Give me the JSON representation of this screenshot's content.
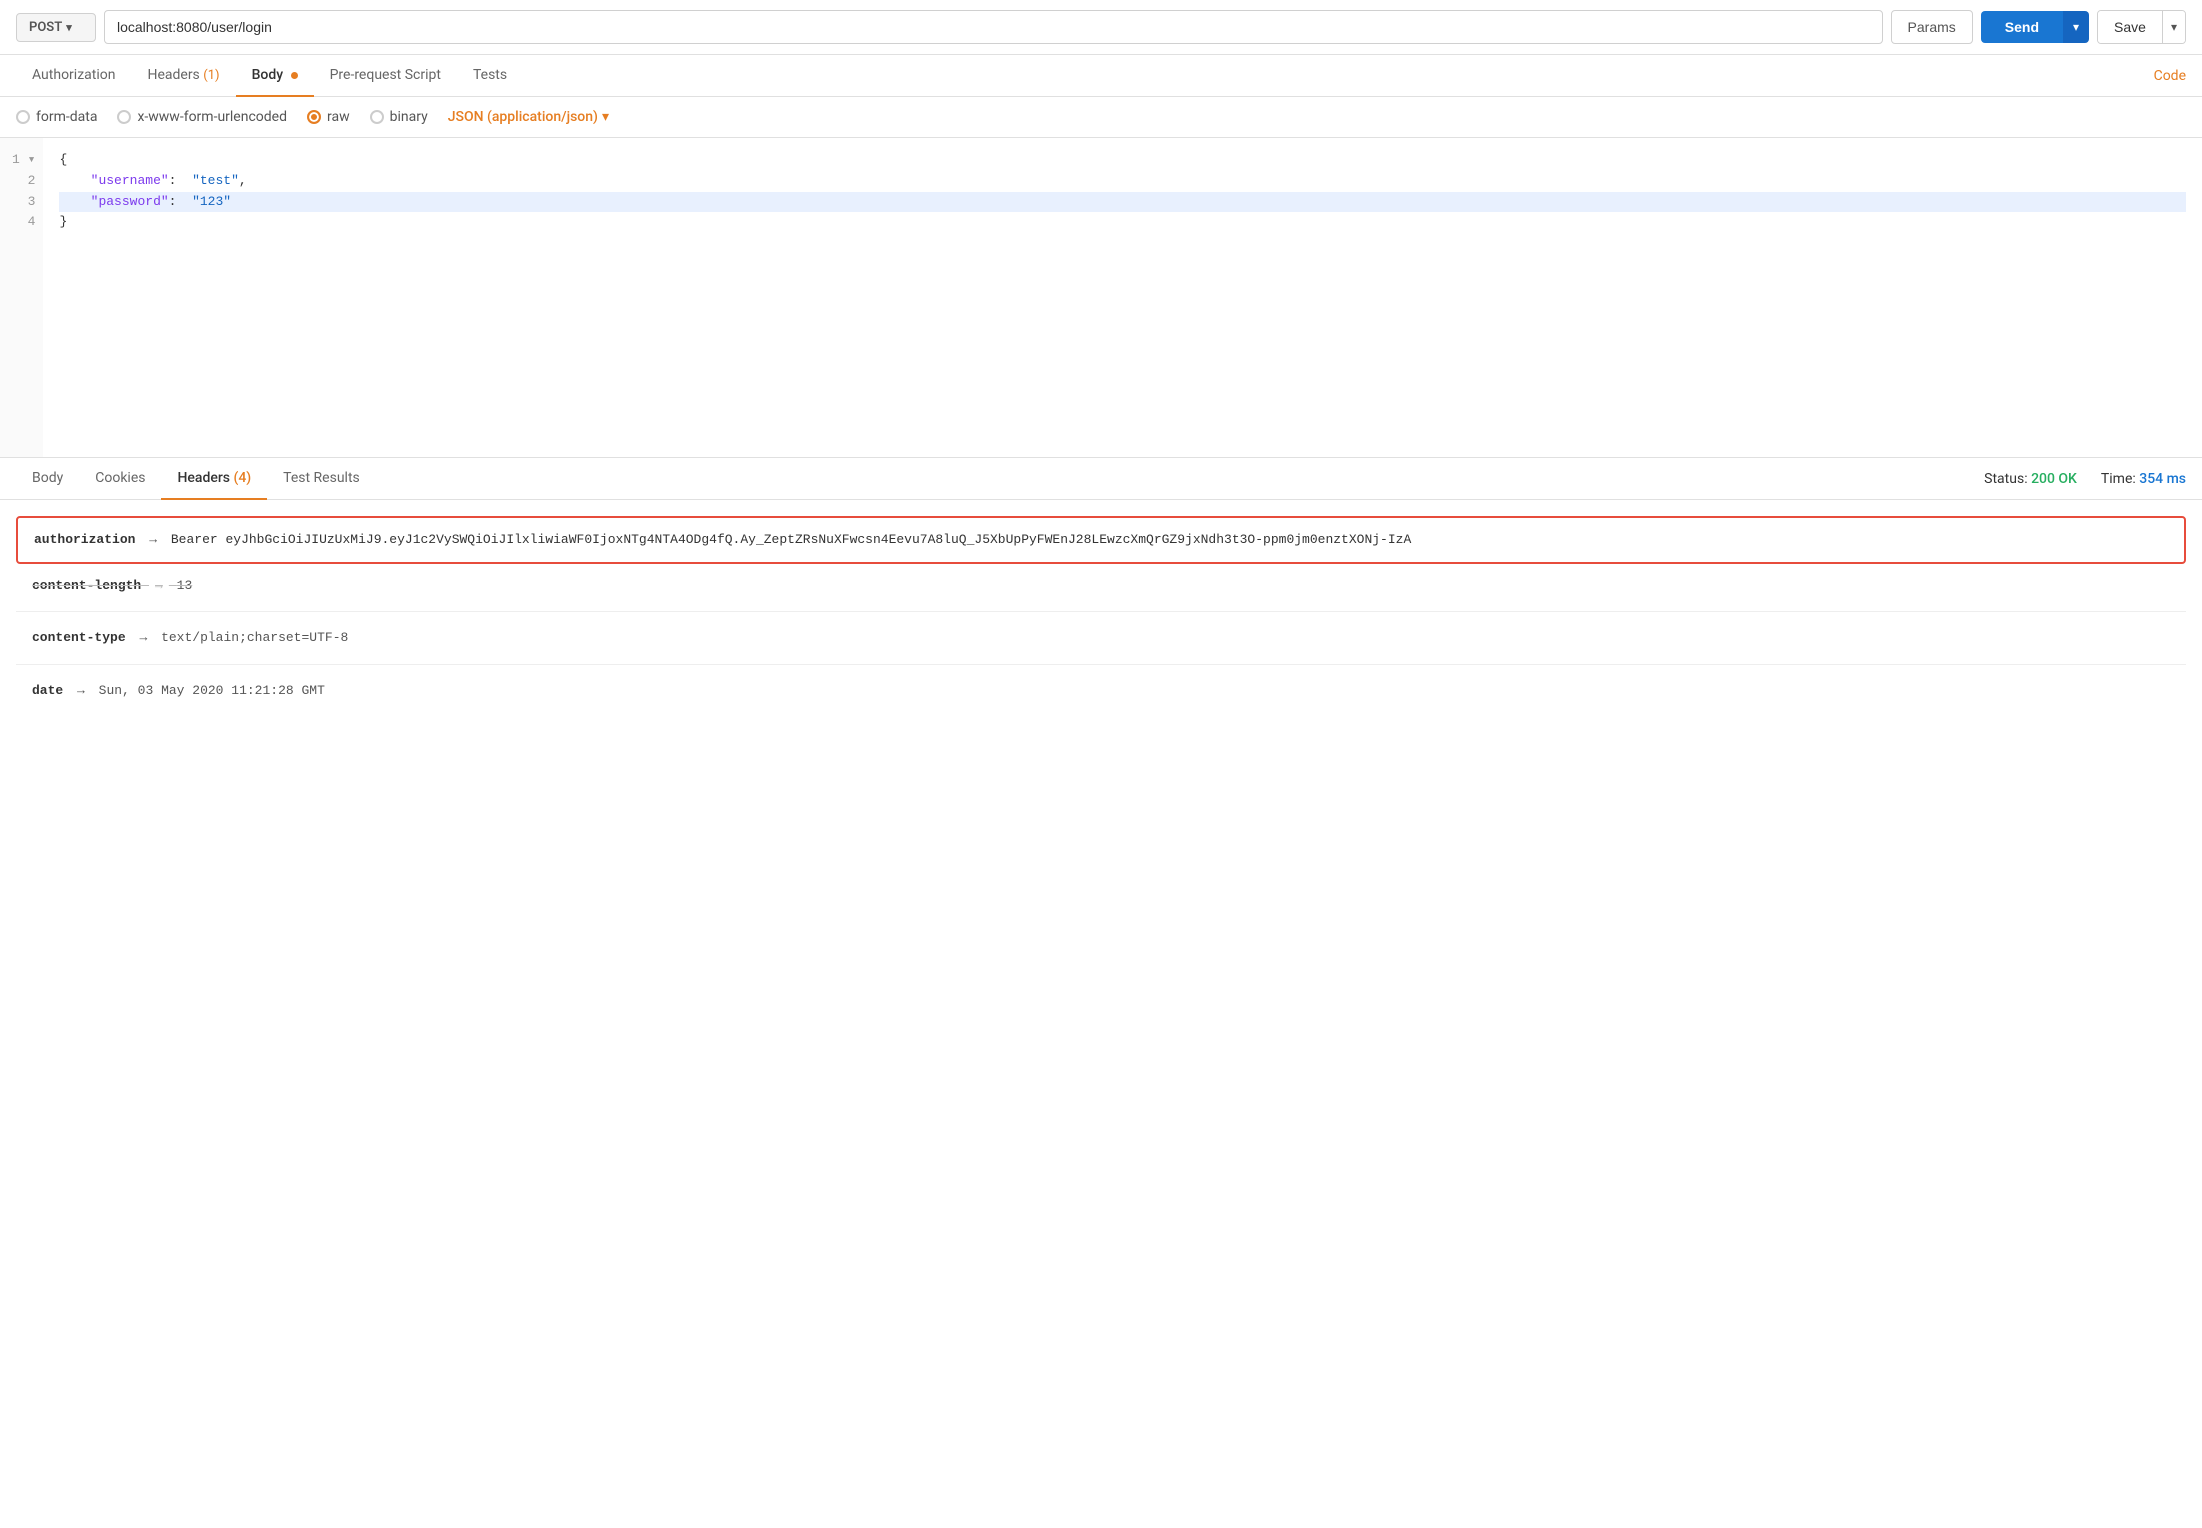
{
  "topbar": {
    "method": "POST",
    "url": "localhost:8080/user/login",
    "params_label": "Params",
    "send_label": "Send",
    "save_label": "Save"
  },
  "request_tabs": [
    {
      "id": "authorization",
      "label": "Authorization",
      "active": false
    },
    {
      "id": "headers",
      "label": "Headers",
      "badge": "(1)",
      "active": false
    },
    {
      "id": "body",
      "label": "Body",
      "dot": true,
      "active": true
    },
    {
      "id": "pre-request",
      "label": "Pre-request Script",
      "active": false
    },
    {
      "id": "tests",
      "label": "Tests",
      "active": false
    }
  ],
  "code_link": "Code",
  "body_options": [
    {
      "id": "form-data",
      "label": "form-data",
      "active": false
    },
    {
      "id": "urlencoded",
      "label": "x-www-form-urlencoded",
      "active": false
    },
    {
      "id": "raw",
      "label": "raw",
      "active": true
    },
    {
      "id": "binary",
      "label": "binary",
      "active": false
    }
  ],
  "format_select": "JSON (application/json)",
  "editor": {
    "lines": [
      {
        "num": "1",
        "content": "{",
        "highlighted": false
      },
      {
        "num": "2",
        "content": "    \"username\":  \"test\",",
        "highlighted": false
      },
      {
        "num": "3",
        "content": "    \"password\":  \"123\"",
        "highlighted": true
      },
      {
        "num": "4",
        "content": "}",
        "highlighted": false
      }
    ]
  },
  "response_tabs": [
    {
      "id": "body",
      "label": "Body",
      "active": false
    },
    {
      "id": "cookies",
      "label": "Cookies",
      "active": false
    },
    {
      "id": "headers",
      "label": "Headers (4)",
      "active": true
    },
    {
      "id": "test-results",
      "label": "Test Results",
      "active": false
    }
  ],
  "response_status": {
    "label": "Status:",
    "code": "200 OK",
    "time_label": "Time:",
    "time_value": "354 ms"
  },
  "response_headers": [
    {
      "id": "authorization",
      "name": "authorization",
      "value": "Bearer eyJhbGciOiJIUzUxMiJ9.eyJ1c2VySWQiOiJIlxliwiaWF0IjoxNTg4NTA4ODg4fQ.Ay_ZeptZRsNuXFwcsn4Eevu7A8luQ_J5XbUpPyFWEnJ28LEwzcXmQrGZ9jxNdh3t3O-ppm0jm0enztXONj-IzA",
      "highlighted": true
    },
    {
      "id": "content-length",
      "name": "content-length",
      "value": "13",
      "highlighted": false,
      "strikethrough": true
    },
    {
      "id": "content-type",
      "name": "content-type",
      "value": "text/plain;charset=UTF-8",
      "highlighted": false
    },
    {
      "id": "date",
      "name": "date",
      "value": "Sun, 03 May 2020 11:21:28 GMT",
      "highlighted": false
    }
  ]
}
